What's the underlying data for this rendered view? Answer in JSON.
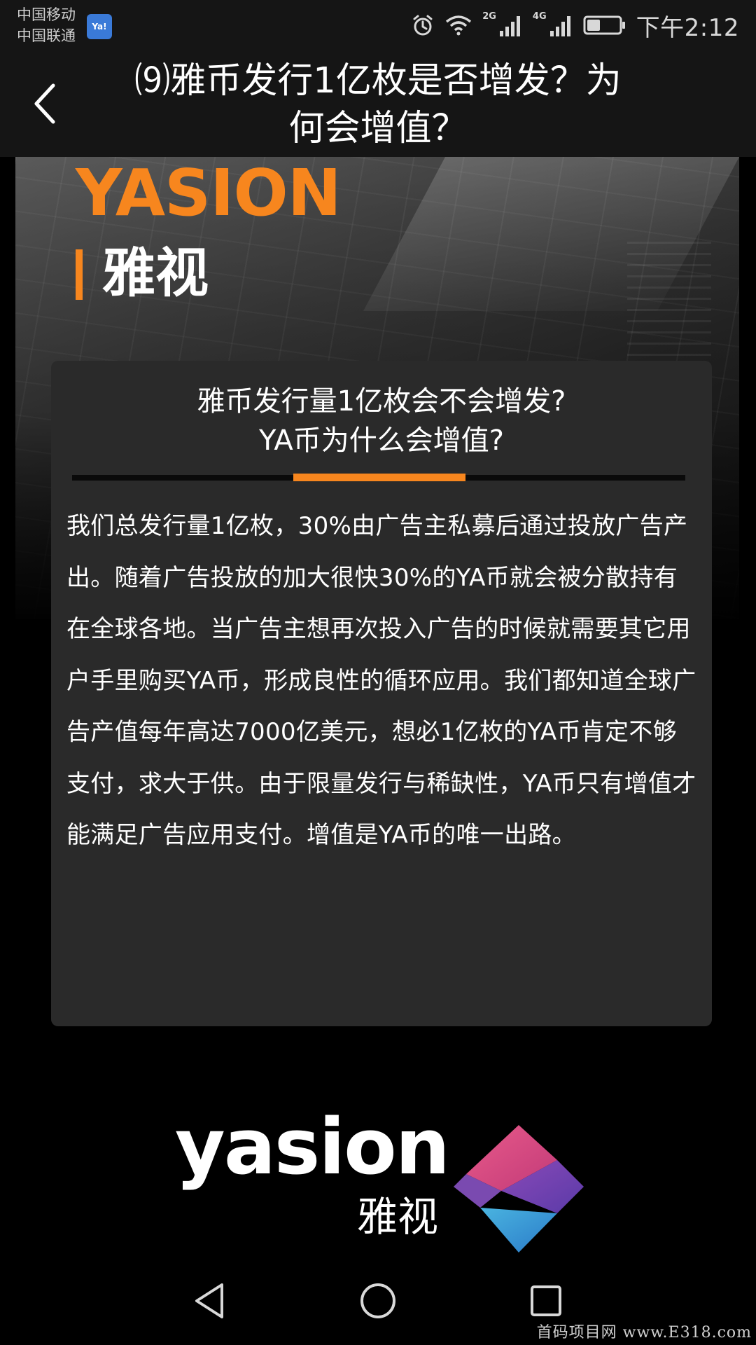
{
  "status_bar": {
    "carrier_1": "中国移动",
    "carrier_2": "中国联通",
    "sim_badge": "Ya!",
    "network_1": "2G",
    "network_2": "4G",
    "time": "下午2:12",
    "icons": [
      "alarm-icon",
      "wifi-icon",
      "signal-icon",
      "signal-icon",
      "battery-icon"
    ]
  },
  "header": {
    "title_line_1": "⑼雅币发行1亿枚是否增发？为",
    "title_line_2": "何会增值？",
    "back_icon": "chevron-left-icon"
  },
  "hero": {
    "brand_word": "YASION",
    "brand_cn": "雅视",
    "accent_color": "#f7861e"
  },
  "card": {
    "title_line_1": "雅币发行量1亿枚会不会增发?",
    "title_line_2": "YA币为什么会增值?",
    "body": "我们总发行量1亿枚，30%由广告主私募后通过投放广告产出。随着广告投放的加大很快30%的YA币就会被分散持有在全球各地。当广告主想再次投入广告的时候就需要其它用户手里购买YA币，形成良性的循环应用。我们都知道全球广告产值每年高达7000亿美元，想必1亿枚的YA币肯定不够支付，求大于供。由于限量发行与稀缺性，YA币只有增值才能满足广告应用支付。增值是YA币的唯一出路。"
  },
  "footer_logo": {
    "wordmark": "yasion",
    "cn": "雅视"
  },
  "nav_bar": {
    "buttons": [
      "back-triangle-icon",
      "home-circle-icon",
      "recent-square-icon"
    ]
  },
  "watermark": "首码项目网 www.E318.com"
}
